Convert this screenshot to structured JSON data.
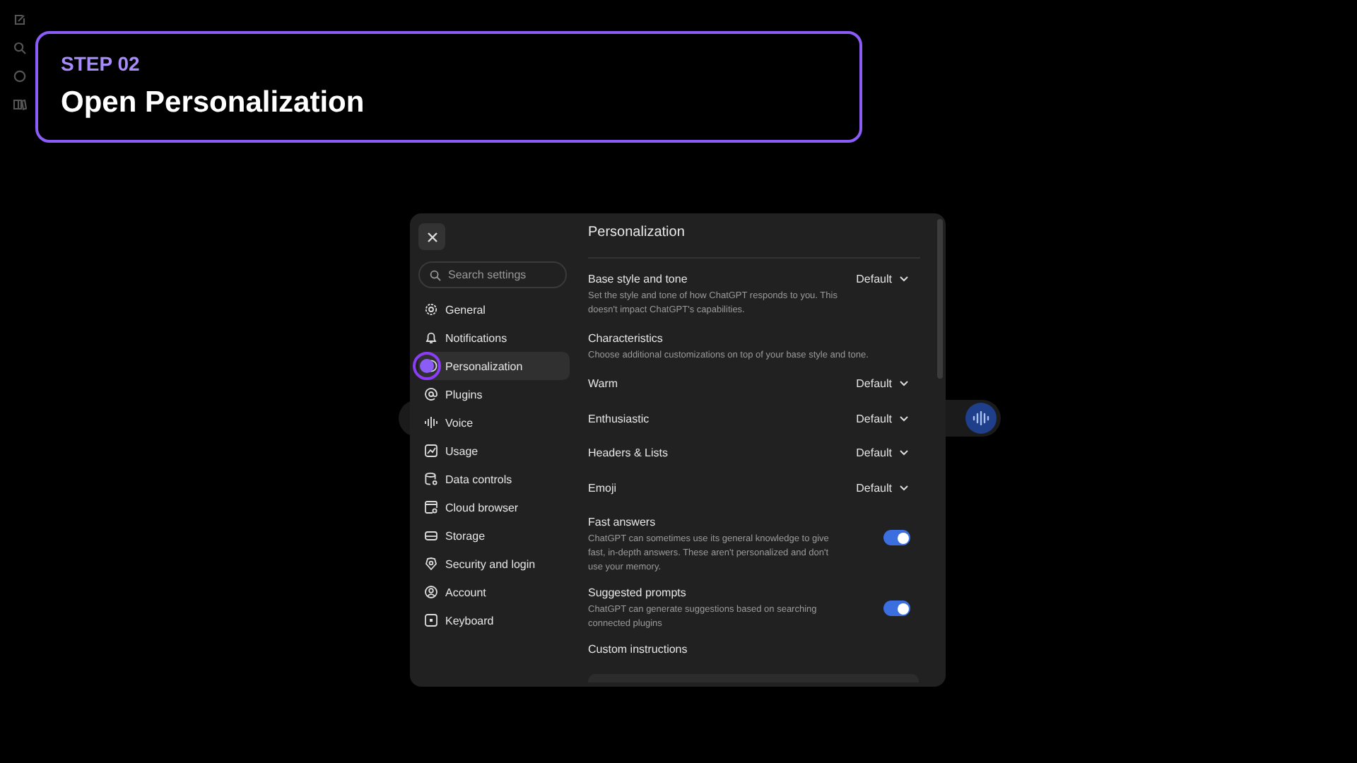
{
  "step": {
    "label": "STEP 02",
    "title": "Open Personalization"
  },
  "settings": {
    "search": {
      "placeholder": "Search settings"
    },
    "sidebar": {
      "items": [
        {
          "label": "General",
          "selected": false
        },
        {
          "label": "Notifications",
          "selected": false
        },
        {
          "label": "Personalization",
          "selected": true
        },
        {
          "label": "Plugins",
          "selected": false
        },
        {
          "label": "Voice",
          "selected": false
        },
        {
          "label": "Usage",
          "selected": false
        },
        {
          "label": "Data controls",
          "selected": false
        },
        {
          "label": "Cloud browser",
          "selected": false
        },
        {
          "label": "Storage",
          "selected": false
        },
        {
          "label": "Security and login",
          "selected": false
        },
        {
          "label": "Account",
          "selected": false
        },
        {
          "label": "Keyboard",
          "selected": false
        }
      ]
    },
    "content": {
      "title": "Personalization",
      "rows": [
        {
          "kind": "dropdown",
          "label": "Base style and tone",
          "description": "Set the style and tone of how ChatGPT responds to you. This doesn't impact ChatGPT's capabilities.",
          "value": "Default"
        },
        {
          "kind": "section",
          "label": "Characteristics",
          "description": "Choose additional customizations on top of your base style and tone."
        },
        {
          "kind": "dropdown",
          "label": "Warm",
          "value": "Default"
        },
        {
          "kind": "dropdown",
          "label": "Enthusiastic",
          "value": "Default"
        },
        {
          "kind": "dropdown",
          "label": "Headers & Lists",
          "value": "Default"
        },
        {
          "kind": "dropdown",
          "label": "Emoji",
          "value": "Default"
        },
        {
          "kind": "toggle",
          "label": "Fast answers",
          "description": "ChatGPT can sometimes use its general knowledge to give fast, in-depth answers. These aren't personalized and don't use your memory.",
          "on": true
        },
        {
          "kind": "toggle",
          "label": "Suggested prompts",
          "description": "ChatGPT can generate suggestions based on searching connected plugins",
          "on": true
        },
        {
          "kind": "section",
          "label": "Custom instructions"
        }
      ]
    }
  }
}
